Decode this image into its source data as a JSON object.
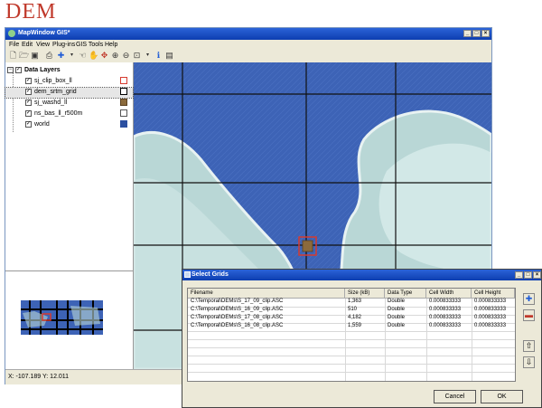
{
  "logo": "DEM",
  "window": {
    "title": "MapWindow GIS*",
    "controls": [
      "_",
      "□",
      "×"
    ]
  },
  "menu": [
    "File",
    "Edit",
    "View",
    "Plug-ins",
    "GIS Tools",
    "Help"
  ],
  "toolbar_icons": [
    "new-icon",
    "open-icon",
    "save-icon",
    "print-icon",
    "add-layer-icon",
    "pointer-icon",
    "pan-icon",
    "zoom-in-icon",
    "zoom-out-icon",
    "zoom-extent-icon",
    "identify-icon",
    "table-icon"
  ],
  "legend": {
    "group": "Data Layers",
    "layers": [
      {
        "name": "sj_clip_box_ll",
        "swatch": "#ffffff",
        "border": "#d63b2f"
      },
      {
        "name": "dem_srtm_grid",
        "swatch": "#ffffff",
        "border": "#000000"
      },
      {
        "name": "sj_washd_ll",
        "swatch": "#8b6a3c",
        "border": "#5a4020"
      },
      {
        "name": "ns_bas_ll_r500m",
        "swatch": "#ffffff",
        "border": "#555555"
      },
      {
        "name": "world",
        "swatch": "#2b4fa0",
        "border": "#2b4fa0"
      }
    ]
  },
  "status": "X: -107.189  Y: 12.011",
  "colors": {
    "ocean": "#3d63b6",
    "land": "#b9d7d6",
    "highlight": "#d63b2f"
  },
  "dialog": {
    "title": "Select Grids",
    "columns": [
      "Filename",
      "Size (kB)",
      "Data Type",
      "Cell Width",
      "Cell Height"
    ],
    "rows": [
      [
        "C:\\Temporal\\DEMs\\S_17_09_clip.ASC",
        "1,363",
        "Double",
        "0.000833333",
        "0.000833333"
      ],
      [
        "C:\\Temporal\\DEMs\\S_16_09_clip.ASC",
        "510",
        "Double",
        "0.000833333",
        "0.000833333"
      ],
      [
        "C:\\Temporal\\DEMs\\S_17_08_clip.ASC",
        "4,182",
        "Double",
        "0.000833333",
        "0.000833333"
      ],
      [
        "C:\\Temporal\\DEMs\\S_16_08_clip.ASC",
        "1,559",
        "Double",
        "0.000833333",
        "0.000833333"
      ]
    ],
    "cancel": "Cancel",
    "ok": "OK"
  }
}
